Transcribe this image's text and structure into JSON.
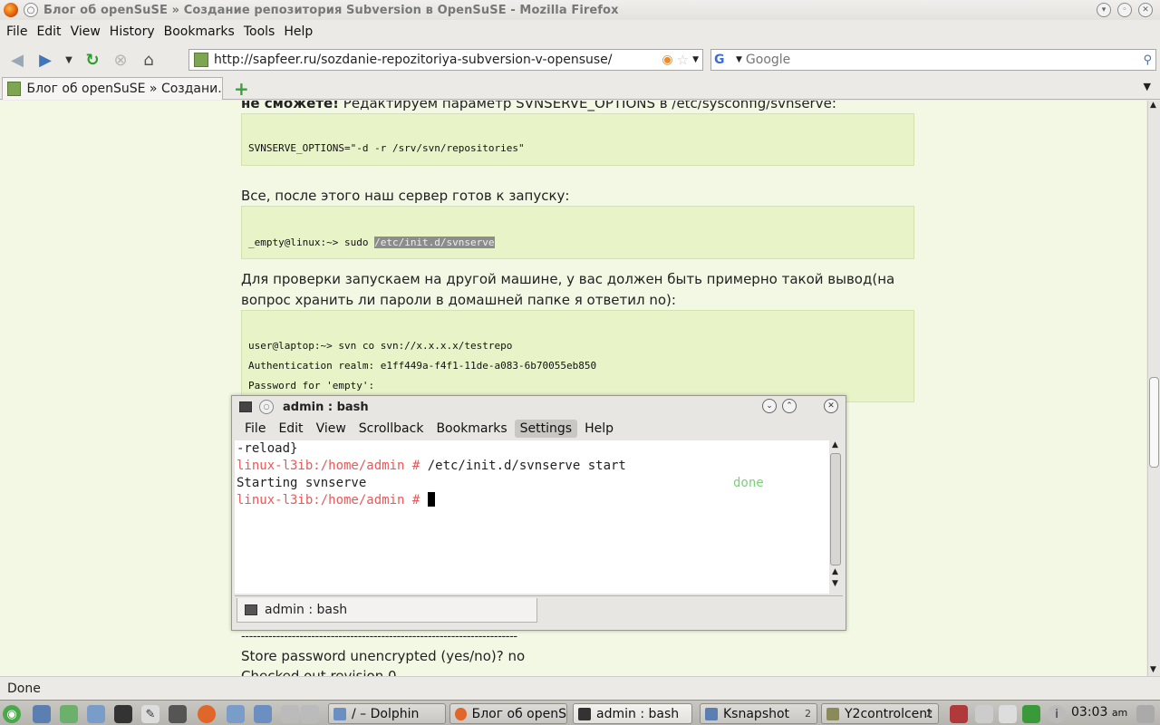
{
  "window": {
    "title": "Блог об openSuSE » Создание репозитория Subversion в OpenSuSE - Mozilla Firefox"
  },
  "menu": [
    "File",
    "Edit",
    "View",
    "History",
    "Bookmarks",
    "Tools",
    "Help"
  ],
  "nav": {
    "url": "http://sapfeer.ru/sozdanie-repozitoriya-subversion-v-opensuse/",
    "search_placeholder": "Google"
  },
  "tabs": {
    "active_label": "Блог об openSuSE » Создани..."
  },
  "content": {
    "para1_bold": "не сможете!",
    "para1_rest": " Редактируем параметр SVNSERVE_OPTIONS в /etc/sysconfig/svnserve:",
    "code1": "SVNSERVE_OPTIONS=\"-d -r /srv/svn/repositories\"",
    "para2": "Все, после этого наш сервер готов к запуску:",
    "code2_prefix": "_empty@linux:~> sudo ",
    "code2_highlight": "/etc/init.d/svnserve",
    "para3_line1": "Для проверки запускаем на другой машине, у вас должен быть примерно такой вывод(на",
    "para3_line2": "вопрос хранить ли пароли в домашней папке я ответил no):",
    "code3": [
      "user@laptop:~> svn co svn://x.x.x.x/testrepo",
      "Authentication realm: e1ff449a-f4f1-11de-a083-6b70055eb850",
      "Password for 'empty':"
    ],
    "dashes": "-----------------------------------------------------------------------",
    "line_store": "Store password unencrypted (yes/no)? no",
    "line_checked": "Checked out revision 0."
  },
  "konsole": {
    "title": "admin : bash",
    "menu": [
      "File",
      "Edit",
      "View",
      "Scrollback",
      "Bookmarks",
      "Settings",
      "Help"
    ],
    "active_menu": "Settings",
    "lines": {
      "l1": "-reload}",
      "prompt": "linux-l3ib:/home/admin # ",
      "cmd": "/etc/init.d/svnserve start",
      "starting": "Starting svnserve",
      "done": "done"
    },
    "tab_label": "admin : bash"
  },
  "status": {
    "text": "Done"
  },
  "taskbar": {
    "tasks": [
      {
        "label": "/ – Dolphin",
        "count": ""
      },
      {
        "label": "Блог об openS",
        "count": ""
      },
      {
        "label": "admin : bash",
        "count": ""
      },
      {
        "label": "Ksnapshot",
        "count": "2"
      },
      {
        "label": "Y2controlcent",
        "count": "2"
      }
    ],
    "clock": "03:03",
    "ampm": "am"
  },
  "colors": {
    "page_bg": "#f2f8e4",
    "code_bg": "#e8f3c8",
    "prompt": "#e8595a",
    "done": "#7ad17a"
  }
}
